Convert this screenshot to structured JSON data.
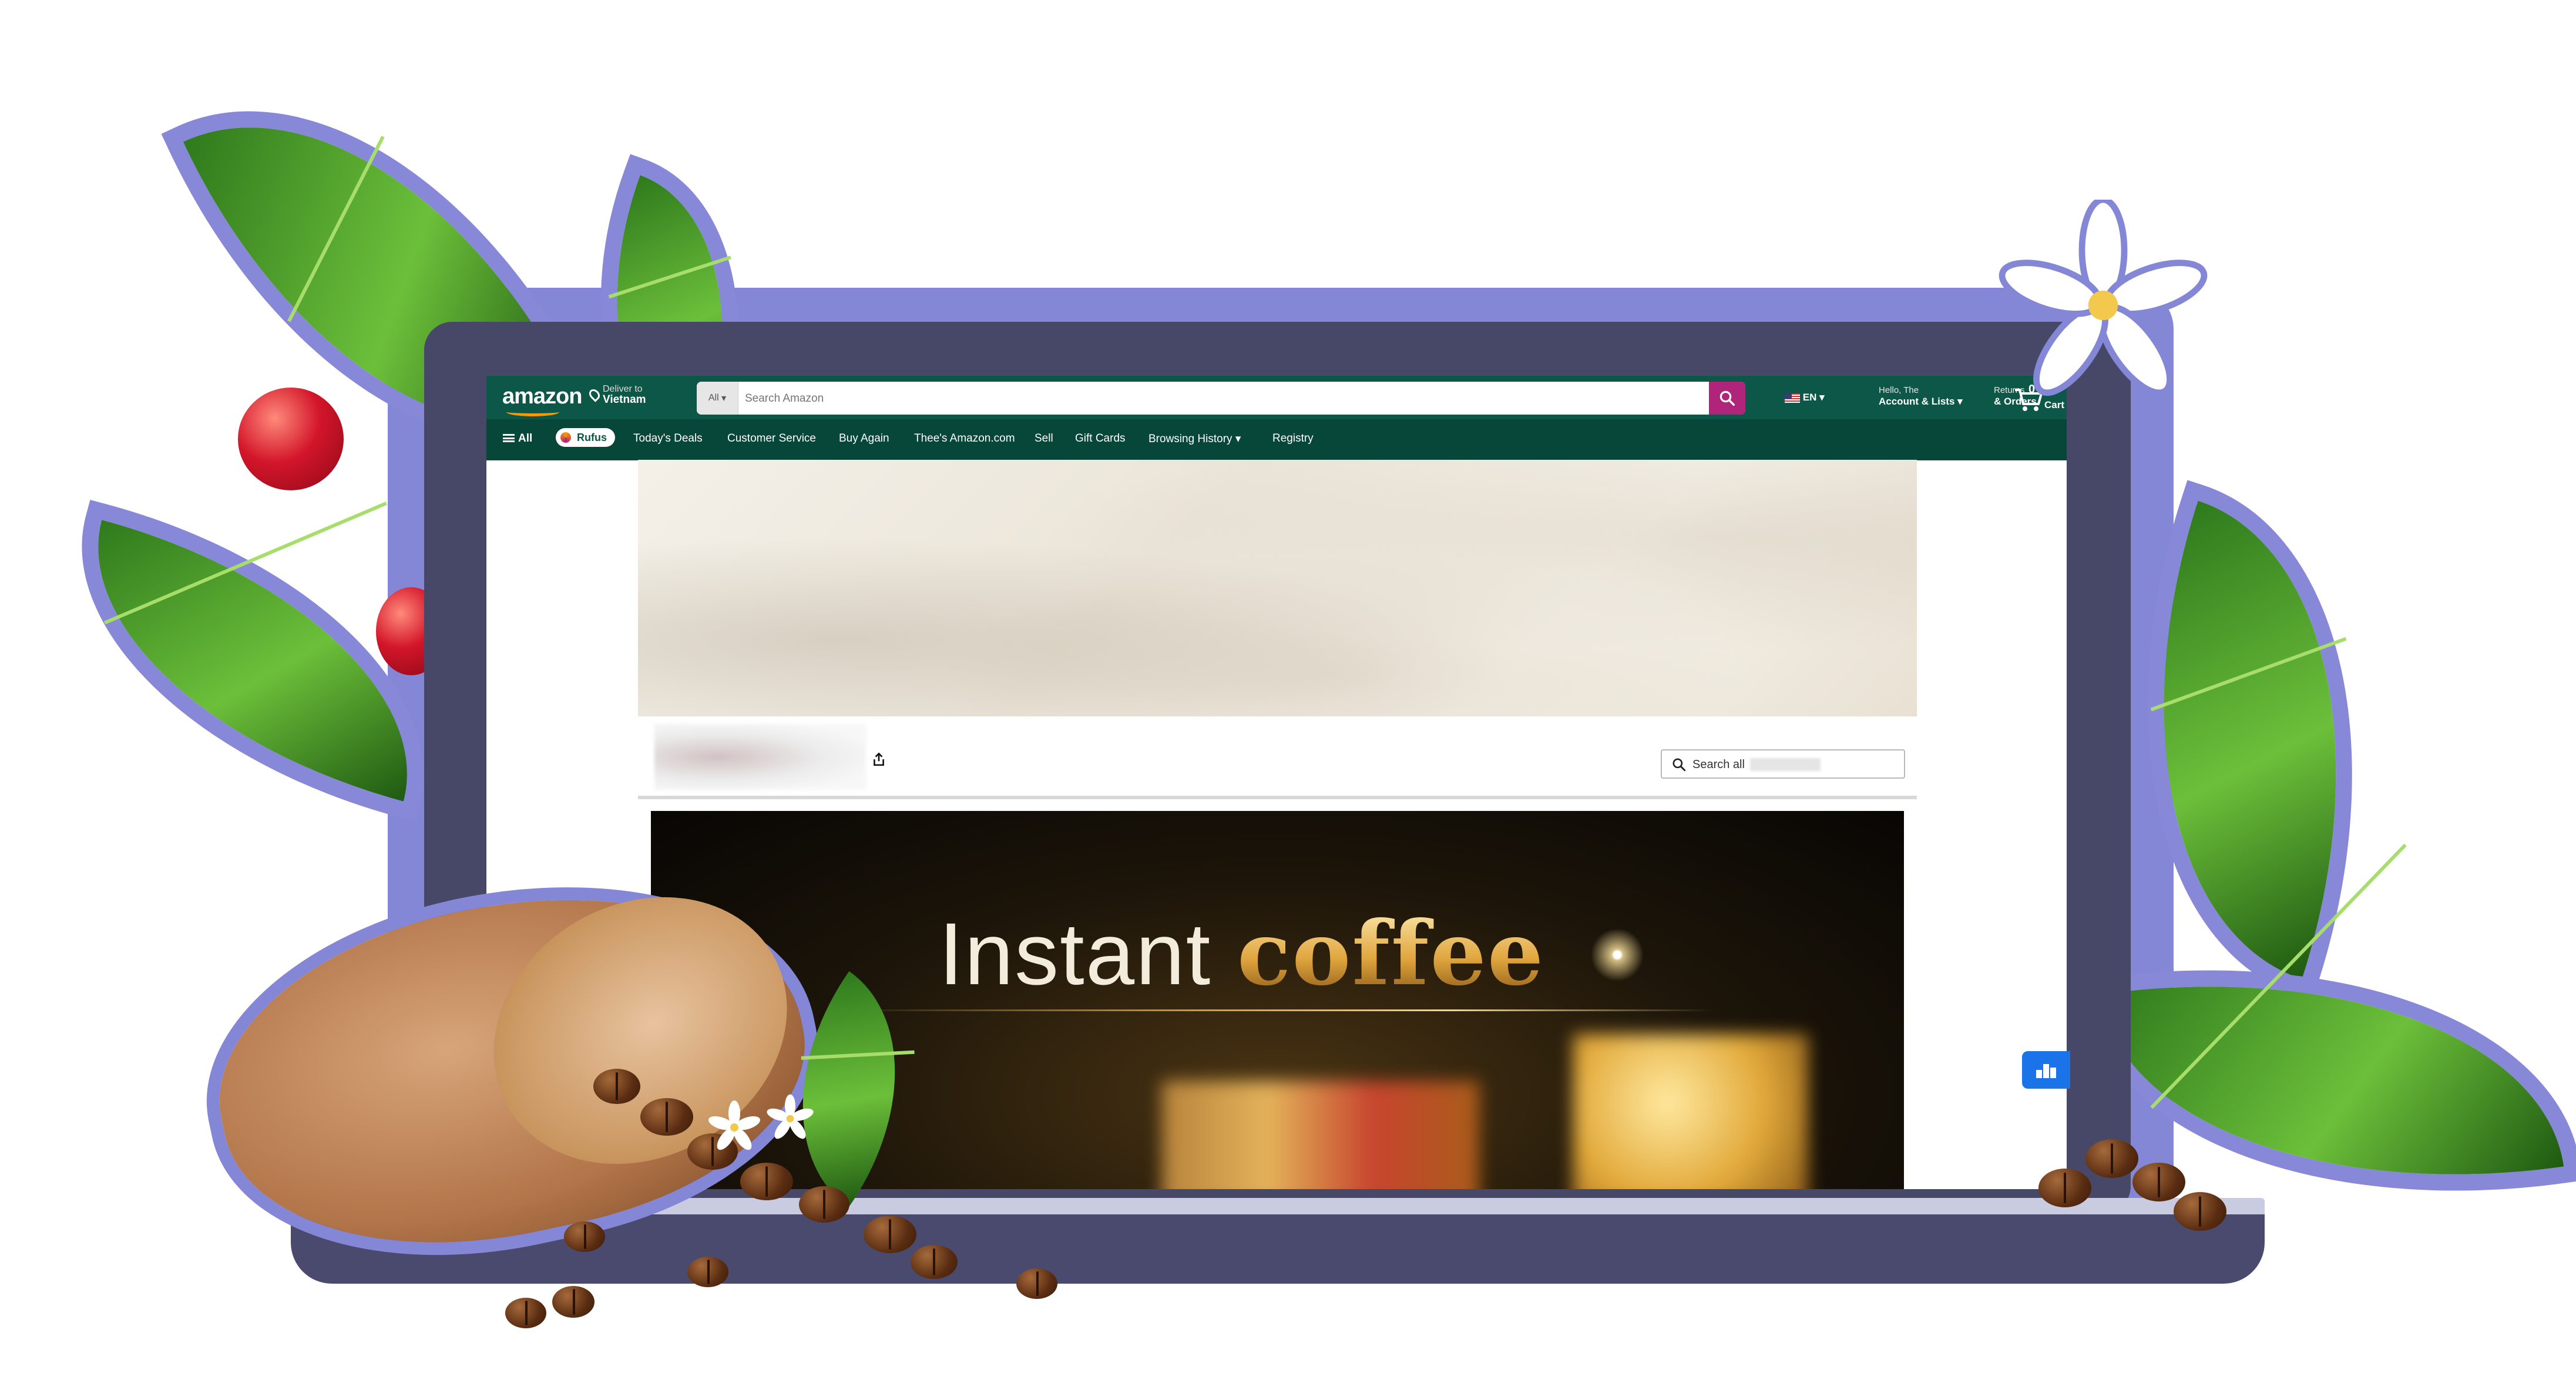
{
  "colors": {
    "header_bg": "#0c5747",
    "subnav_bg": "#06473a",
    "search_button": "#b0257b",
    "laptop_frame": "#474768",
    "halo": "#8486d6",
    "hero_bg": "#1b1409",
    "hero_gold": "#d7a64a"
  },
  "header": {
    "logo_text": "amazon",
    "deliver_line1": "Deliver to",
    "deliver_line2": "Vietnam",
    "search_category": "All",
    "search_placeholder": "Search Amazon",
    "language": "EN",
    "account_line1": "Hello, The",
    "account_line2": "Account & Lists",
    "returns_line1": "Returns",
    "returns_line2": "& Orders",
    "cart_count": "0",
    "cart_label": "Cart"
  },
  "subnav": {
    "all_label": "All",
    "rufus_label": "Rufus",
    "items": [
      "Today's Deals",
      "Customer Service",
      "Buy Again",
      "Thee's Amazon.com",
      "Sell",
      "Gift Cards",
      "Browsing History",
      "Registry"
    ]
  },
  "store": {
    "search_placeholder": "Search all"
  },
  "hero": {
    "title_plain": "Instant",
    "title_gold": "coffee"
  },
  "icons": [
    "menu-icon",
    "location-pin-icon",
    "search-icon",
    "us-flag-icon",
    "cart-icon",
    "share-icon",
    "magnifier-icon",
    "feedback-chart-icon"
  ]
}
